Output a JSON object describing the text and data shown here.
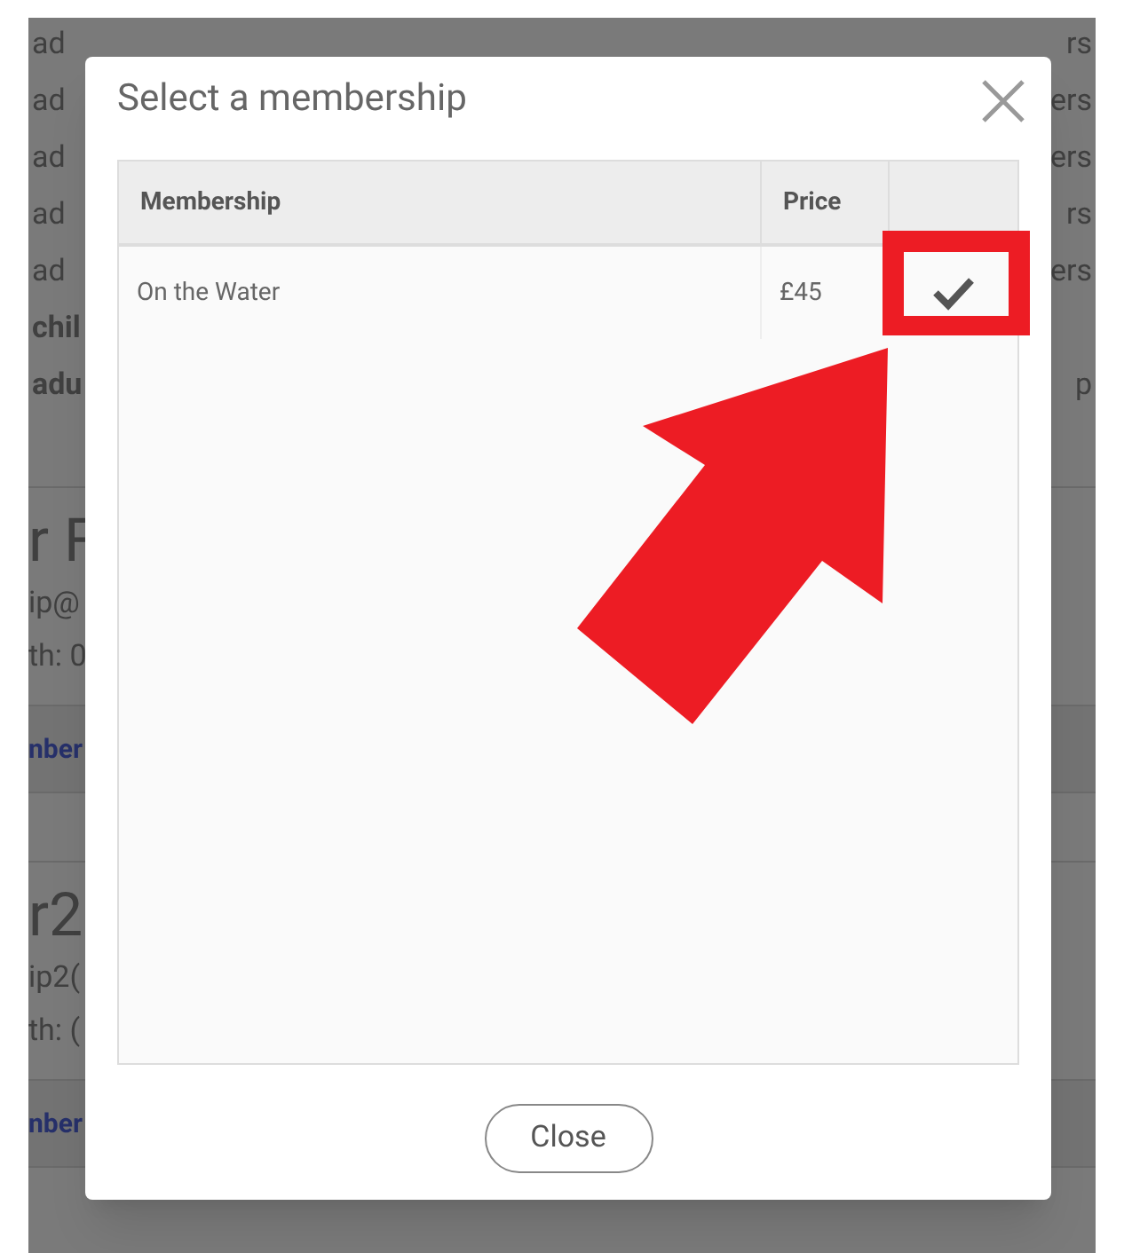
{
  "background": {
    "rows": [
      {
        "left": "ad",
        "right": "rs"
      },
      {
        "left": "ad",
        "right": "ers"
      },
      {
        "left": "ad",
        "right": "ers"
      },
      {
        "left": "ad",
        "right": "rs"
      },
      {
        "left": "ad",
        "right": "ers"
      },
      {
        "left": "chil",
        "bold": true
      },
      {
        "left": "adu",
        "right": "p",
        "bold": true
      }
    ],
    "members": [
      {
        "name": "r F",
        "email": "ip@",
        "birth": "th: 0",
        "link": "nber"
      },
      {
        "name": "r2",
        "email": "ip2(",
        "birth": "th: (",
        "link": "nber"
      }
    ]
  },
  "dialog": {
    "title": "Select a membership",
    "table": {
      "columns": [
        "Membership",
        "Price"
      ],
      "rows": [
        {
          "membership": "On the Water",
          "price": "£45",
          "selected": true
        }
      ]
    },
    "buttons": [
      "Close"
    ]
  }
}
